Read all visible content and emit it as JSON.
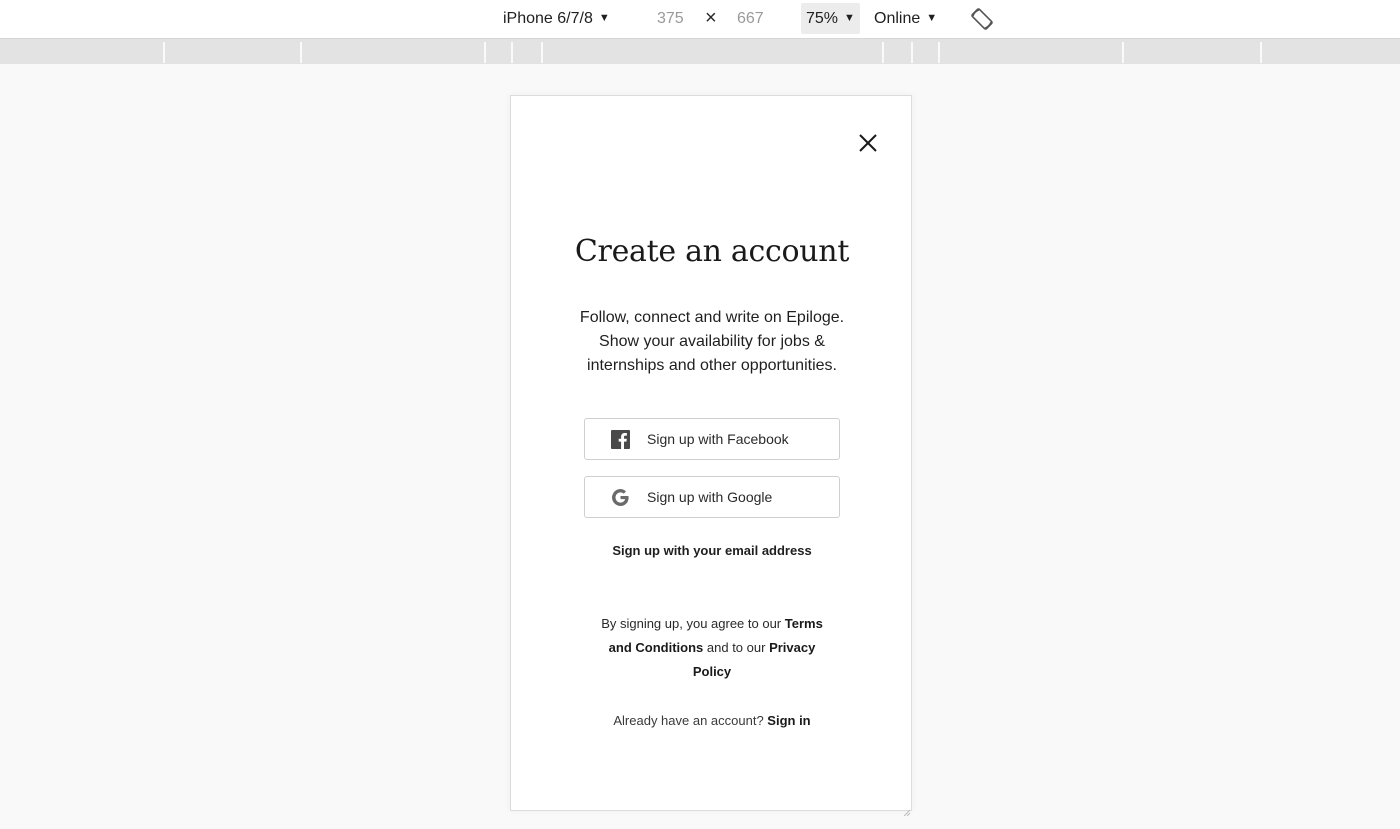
{
  "toolbar": {
    "device": "iPhone 6/7/8",
    "width": "375",
    "times": "×",
    "height": "667",
    "zoom": "75%",
    "network": "Online",
    "caret": "▼"
  },
  "modal": {
    "title": "Create an account",
    "subtitle": "Follow, connect and write on Epiloge. Show your availability for jobs & internships and other opportunities.",
    "facebook_label": "Sign up with Facebook",
    "google_label": "Sign up with Google",
    "email_label": "Sign up with your email address",
    "legal": {
      "prefix": "By signing up, you agree to our ",
      "terms": "Terms and Conditions",
      "middle": " and to our ",
      "privacy": "Privacy Policy"
    },
    "signin_prompt": "Already have an account? ",
    "signin_label": "Sign in"
  },
  "icons": {
    "close": "close-icon",
    "facebook": "facebook-icon",
    "google": "google-icon",
    "rotate": "rotate-icon"
  },
  "colors": {
    "page_background": "#f9f9f9",
    "media_bar": "#e3e3e3",
    "facebook_icon": "#4a4a4a",
    "google_icon": "#6a6a6a"
  }
}
